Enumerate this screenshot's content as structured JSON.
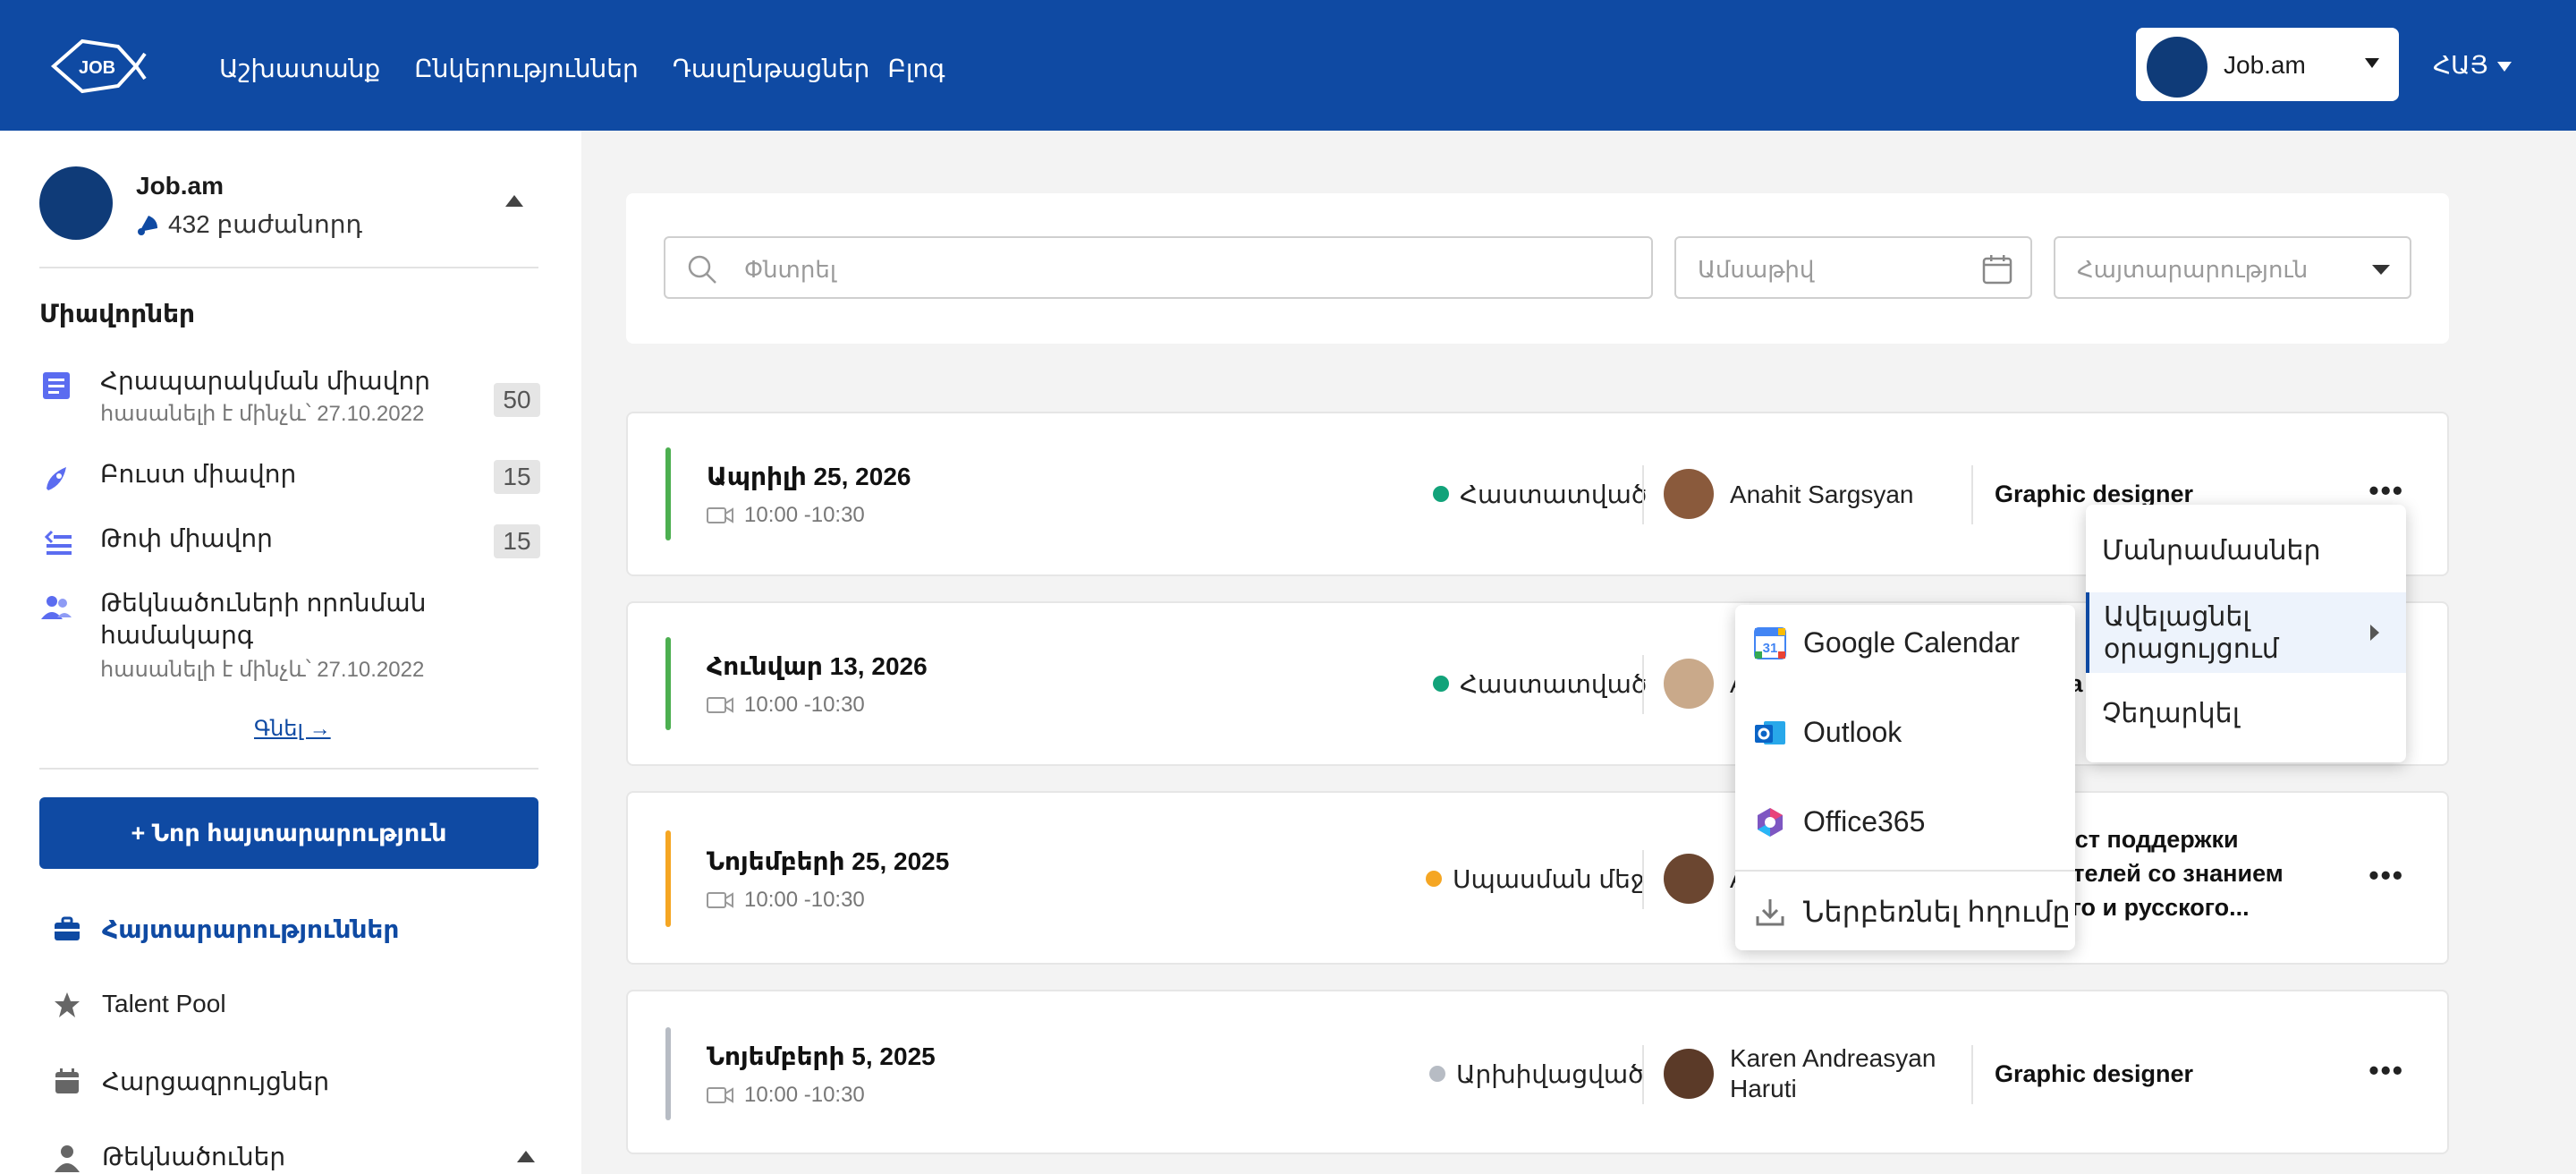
{
  "header": {
    "nav": [
      "Աշխատանք",
      "Ընկերություններ",
      "Դասընթացներ",
      "Բլոգ"
    ],
    "account_name": "Job.am",
    "language": "ՀԱՅ"
  },
  "sidebar": {
    "org_name": "Job.am",
    "followers": "432 բաժանորդ",
    "units_title": "Միավորներ",
    "units": [
      {
        "label": "Հրապարակման միավոր",
        "sub": "հասանելի է մինչև՝ 27.10.2022",
        "count": "50"
      },
      {
        "label": "Բուստ միավոր",
        "count": "15"
      },
      {
        "label": "Թոփ միավոր",
        "count": "15"
      },
      {
        "label": "Թեկնածուների որոնման",
        "label2": "համակարգ",
        "sub": "հասանելի է մինչև՝ 27.10.2022"
      }
    ],
    "buy_link": "Գնել →",
    "new_post_button": "+ Նոր հայտարարություն",
    "menu": [
      {
        "label": "Հայտարարություններ"
      },
      {
        "label": "Talent Pool"
      },
      {
        "label": "Հարցազրույցներ"
      },
      {
        "label": "Թեկնածուներ"
      }
    ]
  },
  "filters": {
    "search_placeholder": "Փնտրել",
    "date_placeholder": "Ամսաթիվ",
    "post_placeholder": "Հայտարարություն"
  },
  "interviews": [
    {
      "date": "Ապրիլի 25, 2026",
      "time": "10:00 -10:30",
      "status": "Հաստատված",
      "status_color": "#12a37a",
      "bar_color": "#4caf50",
      "person": "Anahit Sargsyan",
      "job": "Graphic designer"
    },
    {
      "date": "Հունվար 13, 2026",
      "time": "10:00 -10:30",
      "status": "Հաստատված",
      "status_color": "#12a37a",
      "bar_color": "#4caf50",
      "person": "A",
      "job": "Gra"
    },
    {
      "date": "Նոյեմբերի 25, 2025",
      "time": "10:00 -10:30",
      "status": "Սպասման մեջ",
      "status_color": "#f5a623",
      "bar_color": "#f5a623",
      "person": "A",
      "job_lines": [
        "лист поддержки",
        "вателей со знанием",
        "кого и русского..."
      ]
    },
    {
      "date": "Նոյեմբերի 5, 2025",
      "time": "10:00 -10:30",
      "status": "Արխիվացված",
      "status_color": "#b7bcc4",
      "bar_color": "#b7bcc4",
      "person_line1": "Karen Andreasyan",
      "person_line2": "Haruti",
      "job": "Graphic designer"
    }
  ],
  "context_menu": {
    "details": "Մանրամասներ",
    "add_line1": "Ավելացնել",
    "add_line2": "օրացույցում",
    "cancel": "Չեղարկել"
  },
  "calendar_menu": [
    "Google Calendar",
    "Outlook",
    "Office365",
    "Ներբեռնել հղումը"
  ],
  "more_label": "•••"
}
